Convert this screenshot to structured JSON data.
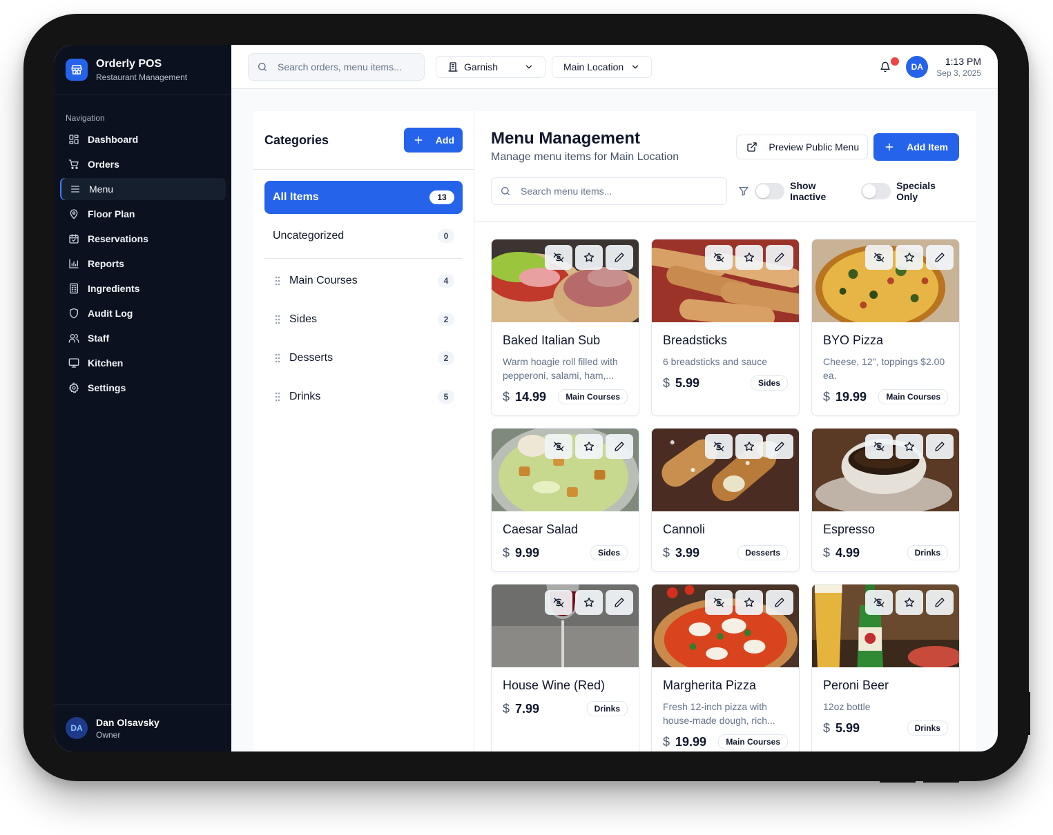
{
  "app": {
    "name": "Orderly POS",
    "subtitle": "Restaurant Management"
  },
  "sidebar": {
    "heading": "Navigation",
    "items": [
      {
        "label": "Dashboard",
        "icon": "grid-icon"
      },
      {
        "label": "Orders",
        "icon": "cart-icon"
      },
      {
        "label": "Menu",
        "icon": "menu-icon",
        "active": true
      },
      {
        "label": "Floor Plan",
        "icon": "map-pin-icon"
      },
      {
        "label": "Reservations",
        "icon": "calendar-icon"
      },
      {
        "label": "Reports",
        "icon": "bar-chart-icon"
      },
      {
        "label": "Ingredients",
        "icon": "clipboard-icon"
      },
      {
        "label": "Audit Log",
        "icon": "shield-icon"
      },
      {
        "label": "Staff",
        "icon": "users-icon"
      },
      {
        "label": "Kitchen",
        "icon": "monitor-icon"
      },
      {
        "label": "Settings",
        "icon": "gear-icon"
      }
    ],
    "user": {
      "initials": "DA",
      "name": "Dan Olsavsky",
      "role": "Owner"
    }
  },
  "topbar": {
    "search_placeholder": "Search orders, menu items...",
    "restaurant": "Garnish",
    "location": "Main Location",
    "avatar_initials": "DA",
    "time": "1:13 PM",
    "date": "Sep 3, 2025"
  },
  "categories": {
    "title": "Categories",
    "add_label": "Add",
    "all": {
      "label": "All Items",
      "count": "13"
    },
    "uncategorized": {
      "label": "Uncategorized",
      "count": "0"
    },
    "list": [
      {
        "label": "Main Courses",
        "count": "4"
      },
      {
        "label": "Sides",
        "count": "2"
      },
      {
        "label": "Desserts",
        "count": "2"
      },
      {
        "label": "Drinks",
        "count": "5"
      }
    ]
  },
  "menu": {
    "title": "Menu Management",
    "subtitle": "Manage menu items for Main Location",
    "preview_label": "Preview Public Menu",
    "add_item_label": "Add Item",
    "search_placeholder": "Search menu items...",
    "show_inactive_label": "Show Inactive",
    "specials_only_label": "Specials Only",
    "currency": "$",
    "items": [
      {
        "name": "Baked Italian Sub",
        "description": "Warm hoagie roll filled with pepperoni, salami, ham,...",
        "price": "14.99",
        "category": "Main Courses"
      },
      {
        "name": "Breadsticks",
        "description": "6 breadsticks and sauce",
        "price": "5.99",
        "category": "Sides"
      },
      {
        "name": "BYO Pizza",
        "description": "Cheese, 12\", toppings $2.00 ea.",
        "price": "19.99",
        "category": "Main Courses"
      },
      {
        "name": "Caesar Salad",
        "description": "",
        "price": "9.99",
        "category": "Sides"
      },
      {
        "name": "Cannoli",
        "description": "",
        "price": "3.99",
        "category": "Desserts"
      },
      {
        "name": "Espresso",
        "description": "",
        "price": "4.99",
        "category": "Drinks"
      },
      {
        "name": "House Wine (Red)",
        "description": "",
        "price": "7.99",
        "category": "Drinks"
      },
      {
        "name": "Margherita Pizza",
        "description": "Fresh 12-inch pizza with house-made dough, rich...",
        "price": "19.99",
        "category": "Main Courses"
      },
      {
        "name": "Peroni Beer",
        "description": "12oz bottle",
        "price": "5.99",
        "category": "Drinks"
      }
    ]
  },
  "colors": {
    "accent": "#2563eb",
    "sidebar_bg": "#0b111e",
    "notification_dot": "#ef4444"
  }
}
